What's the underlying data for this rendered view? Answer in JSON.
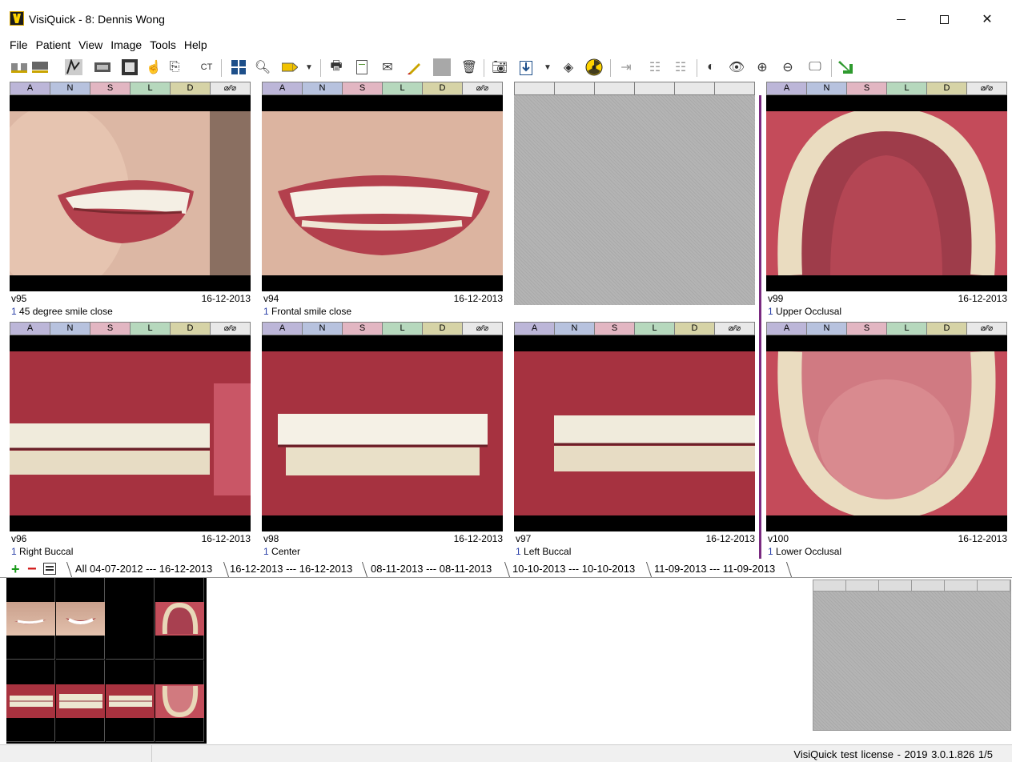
{
  "window": {
    "title": "VisiQuick - 8: Dennis Wong",
    "minimize": "—",
    "maximize": "☐",
    "close": "✕"
  },
  "menu": [
    "File",
    "Patient",
    "View",
    "Image",
    "Tools",
    "Help"
  ],
  "toolbar_icons": [
    "strip-icon",
    "tray-icon",
    "ceph-icon",
    "xray-icon",
    "photo-icon",
    "hand-icon",
    "copy-icon",
    "ct-icon",
    "grid-icon",
    "zoom-icon",
    "tag-icon",
    "dropdown-icon",
    "print-icon",
    "document-icon",
    "mail-icon",
    "pen-icon",
    "gray-square-icon",
    "trash-icon",
    "camera-icon",
    "import-icon",
    "dropdown-icon",
    "stamp-icon",
    "radiation-icon",
    "export-icon",
    "list-icon",
    "list2-icon",
    "contrast-icon",
    "eye-icon",
    "zoom-in-icon",
    "zoom-out-icon",
    "monitor-icon",
    "arrow-icon"
  ],
  "toolbar_ct_label": "CT",
  "tag_labels": {
    "a": "A",
    "n": "N",
    "s": "S",
    "l": "L",
    "d": "D",
    "x": "⌀⁄⁄⌀"
  },
  "cells": [
    {
      "code": "v95",
      "date": "16-12-2013",
      "num": "1",
      "label": "45 degree smile close"
    },
    {
      "code": "v94",
      "date": "16-12-2013",
      "num": "1",
      "label": "Frontal smile close"
    },
    {
      "code": "",
      "date": "",
      "num": "",
      "label": ""
    },
    {
      "code": "v99",
      "date": "16-12-2013",
      "num": "1",
      "label": "Upper Occlusal"
    },
    {
      "code": "v96",
      "date": "16-12-2013",
      "num": "1",
      "label": "Right Buccal"
    },
    {
      "code": "v98",
      "date": "16-12-2013",
      "num": "1",
      "label": "Center"
    },
    {
      "code": "v97",
      "date": "16-12-2013",
      "num": "1",
      "label": "Left Buccal"
    },
    {
      "code": "v100",
      "date": "16-12-2013",
      "num": "1",
      "label": "Lower Occlusal"
    }
  ],
  "tabs": {
    "add": "+",
    "remove": "−",
    "items": [
      "All 04-07-2012 --- 16-12-2013",
      "16-12-2013 --- 16-12-2013",
      "08-11-2013 --- 08-11-2013",
      "10-10-2013 --- 10-10-2013",
      "11-09-2013 --- 11-09-2013"
    ]
  },
  "status": {
    "text": "VisiQuick test license - 2019   3.0.1.826   1/5"
  },
  "colors": {
    "divider": "#7a2a80",
    "tag_a": "#bcb6d8",
    "tag_n": "#b7c2de",
    "tag_s": "#e2b6c2",
    "tag_l": "#b6d8bd",
    "tag_d": "#d6d3a6"
  }
}
